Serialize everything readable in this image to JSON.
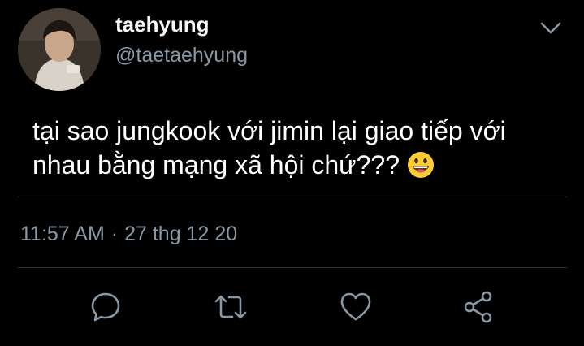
{
  "tweet": {
    "author": {
      "display_name": "taehyung",
      "handle": "@taetaehyung"
    },
    "text_line1": "tại sao jungkook với jimin lại giao tiếp với",
    "text_line2": "nhau bằng mạng xã hội chứ???",
    "emoji": "grinning-face-emoji",
    "time": "11:57 AM",
    "separator": "·",
    "date": "27 thg 12 20"
  },
  "actions": [
    {
      "name": "reply",
      "icon": "reply-bubble-icon"
    },
    {
      "name": "retweet",
      "icon": "retweet-arrows-icon"
    },
    {
      "name": "like",
      "icon": "heart-icon"
    },
    {
      "name": "share",
      "icon": "share-nodes-icon"
    }
  ],
  "colors": {
    "background": "#000000",
    "text_primary": "#ffffff",
    "text_secondary": "#8899a6",
    "icon": "#8899a6",
    "divider": "#2f3336"
  }
}
